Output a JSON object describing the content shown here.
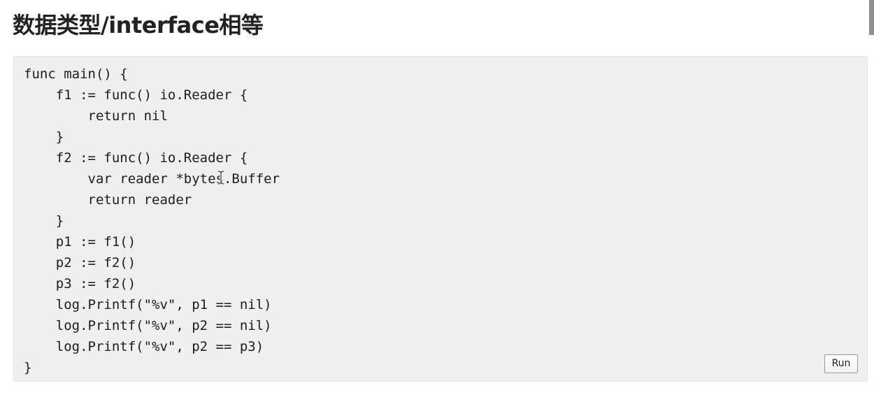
{
  "page": {
    "title": "数据类型/interface相等"
  },
  "code": {
    "lines": [
      "func main() {",
      "    f1 := func() io.Reader {",
      "        return nil",
      "    }",
      "    f2 := func() io.Reader {",
      "        var reader *bytes.Buffer",
      "        return reader",
      "    }",
      "    p1 := f1()",
      "    p2 := f2()",
      "    p3 := f2()",
      "    log.Printf(\"%v\", p1 == nil)",
      "    log.Printf(\"%v\", p2 == nil)",
      "    log.Printf(\"%v\", p2 == p3)",
      "}"
    ],
    "run_label": "Run"
  },
  "icons": {
    "cursor": "text-cursor-icon",
    "scrollbar": "scrollbar-thumb"
  }
}
